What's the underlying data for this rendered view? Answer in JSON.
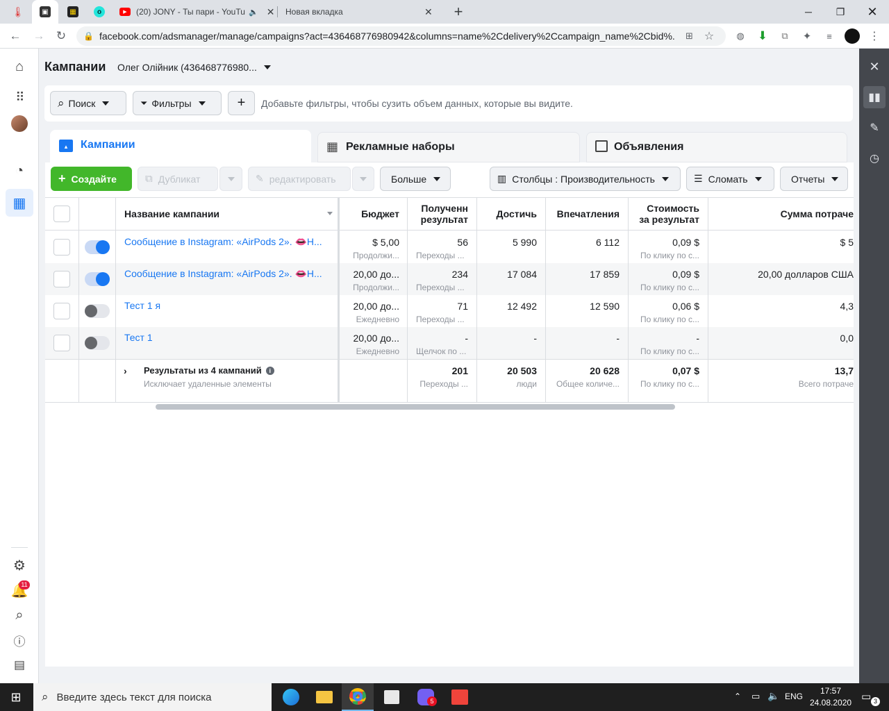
{
  "browser": {
    "tabs": [
      {
        "title": "",
        "icon": "thermometer-icon"
      },
      {
        "title": "",
        "icon": "image-icon"
      },
      {
        "title": "",
        "icon": "spreadsheet-icon"
      },
      {
        "title": "",
        "icon": "olx-icon"
      },
      {
        "title": "(20) JONY - Ты пари - YouTu",
        "icon": "youtube-icon"
      },
      {
        "title": "Новая вкладка",
        "icon": ""
      }
    ],
    "new_tab": "+",
    "url": "facebook.com/adsmanager/manage/campaigns?act=436468776980942&columns=name%2Cdelivery%2Ccampaign_name%2Cbid%..."
  },
  "header": {
    "title": "Кампании",
    "account": "Олег Олійник (436468776980..."
  },
  "filterbar": {
    "search_label": "Поиск",
    "filters_label": "Фильтры",
    "add_label": "+",
    "hint": "Добавьте фильтры, чтобы сузить объем данных, которые вы видите."
  },
  "tabs": {
    "campaigns": "Кампании",
    "adsets": "Рекламные наборы",
    "ads": "Объявления"
  },
  "toolbar": {
    "create": "Создайте",
    "duplicate": "Дубликат",
    "edit": "редактировать",
    "more": "Больше",
    "columns": "Столбцы : Производительность",
    "breakdown": "Сломать",
    "reports": "Отчеты"
  },
  "table": {
    "headers": {
      "name": "Название кампании",
      "budget": "Бюджет",
      "results_1": "Полученн",
      "results_2": "результат",
      "reach": "Достичь",
      "impressions": "Впечатления",
      "cost_1": "Стоимость",
      "cost_2": "за результат",
      "spent": "Сумма потраче"
    },
    "rows": [
      {
        "name": "Сообщение в Instagram: «AirPods 2». 👄Н...",
        "on": true,
        "budget": "$ 5,00",
        "budget_sub": "Продолжи...",
        "results": "56",
        "results_sub": "Переходы ...",
        "reach": "5 990",
        "impressions": "6 112",
        "cost": "0,09 $",
        "cost_sub": "По клику по с...",
        "spent": "$ 5"
      },
      {
        "name": "Сообщение в Instagram: «AirPods 2». 👄Н...",
        "on": true,
        "budget": "20,00 до...",
        "budget_sub": "Продолжи...",
        "results": "234",
        "results_sub": "Переходы ...",
        "reach": "17 084",
        "impressions": "17 859",
        "cost": "0,09 $",
        "cost_sub": "По клику по с...",
        "spent": "20,00 долларов США"
      },
      {
        "name": "Тест 1 я",
        "on": false,
        "budget": "20,00 до...",
        "budget_sub": "Ежедневно",
        "results": "71",
        "results_sub": "Переходы ...",
        "reach": "12 492",
        "impressions": "12 590",
        "cost": "0,06 $",
        "cost_sub": "По клику по с...",
        "spent": "4,3"
      },
      {
        "name": "Тест 1",
        "on": false,
        "budget": "20,00 до...",
        "budget_sub": "Ежедневно",
        "results": "-",
        "results_sub": "Щелчок по ...",
        "reach": "-",
        "impressions": "-",
        "cost": "-",
        "cost_sub": "По клику по с...",
        "spent": "0,0"
      }
    ],
    "summary": {
      "label": "Результаты из 4 кампаний",
      "sub": "Исключает удаленные элементы",
      "results": "201",
      "results_sub": "Переходы ...",
      "reach": "20 503",
      "reach_sub": "люди",
      "impressions": "20 628",
      "impressions_sub": "Общее количе...",
      "cost": "0,07 $",
      "cost_sub": "По клику по с...",
      "spent": "13,7",
      "spent_sub": "Всего потраче"
    }
  },
  "leftrail": {
    "notifications_count": "11"
  },
  "taskbar": {
    "search_placeholder": "Введите здесь текст для поиска",
    "lang": "ENG",
    "time": "17:57",
    "date": "24.08.2020",
    "viber_badge": "5",
    "notif_count": "3"
  },
  "colors": {
    "brand_blue": "#1877f2",
    "create_green": "#42b72a",
    "taskbar": "#1f1f1f"
  }
}
